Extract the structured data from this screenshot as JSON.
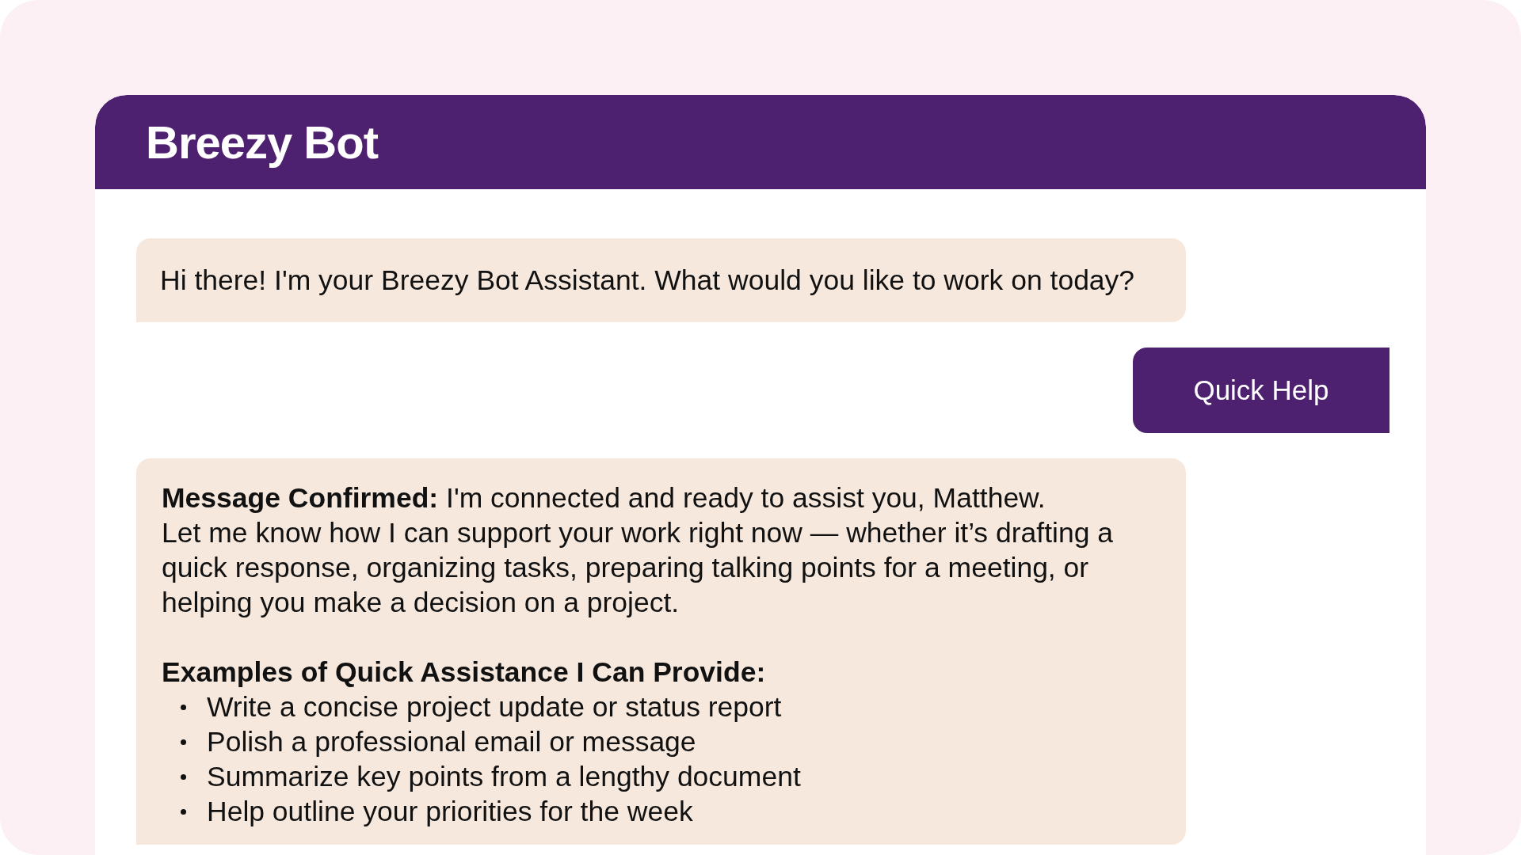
{
  "header": {
    "title": "Breezy Bot"
  },
  "messages": [
    {
      "kind": "bot_text",
      "text": "Hi there! I'm your Breezy Bot Assistant. What would you like to work on today?"
    },
    {
      "kind": "user_button",
      "text": "Quick Help"
    },
    {
      "kind": "bot_rich",
      "lines": [
        "**Message Confirmed:** I'm connected and ready to assist you, Matthew.",
        "Let me know how I can support your work right now — whether it’s drafting a quick response, organizing tasks, preparing talking points for a meeting, or helping you make a decision on a project."
      ],
      "heading": "Examples of Quick Assistance I Can Provide:",
      "bullets": [
        "Write a concise project update or status report",
        "Polish a professional email or message",
        "Summarize key points from a lengthy document",
        "Help outline your priorities for the week"
      ]
    }
  ]
}
